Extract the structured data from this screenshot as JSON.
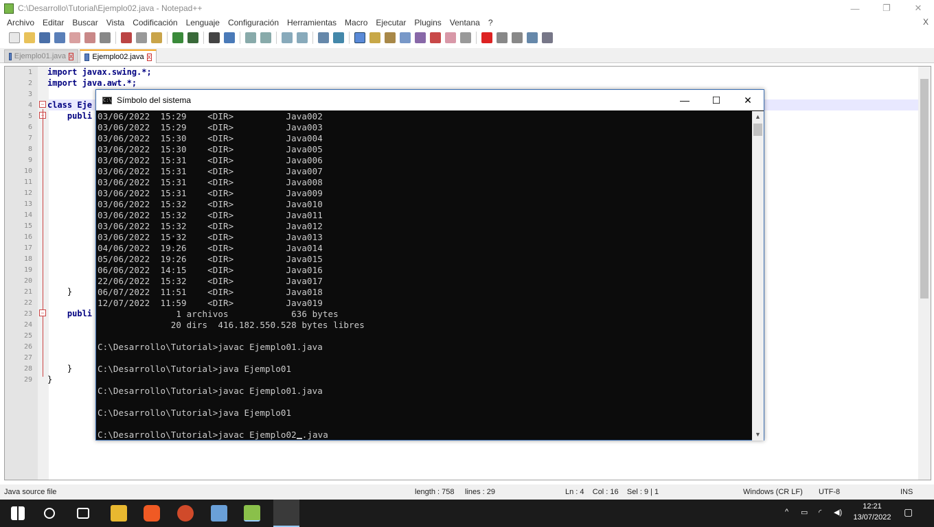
{
  "window": {
    "title": "C:\\Desarrollo\\Tutorial\\Ejemplo02.java - Notepad++"
  },
  "menu": [
    "Archivo",
    "Editar",
    "Buscar",
    "Vista",
    "Codificación",
    "Lenguaje",
    "Configuración",
    "Herramientas",
    "Macro",
    "Ejecutar",
    "Plugins",
    "Ventana",
    "?"
  ],
  "menu_close": "X",
  "tabs": [
    {
      "label": "Ejemplo01.java",
      "active": false
    },
    {
      "label": "Ejemplo02.java",
      "active": true
    }
  ],
  "editor": {
    "line_numbers": [
      "1",
      "2",
      "3",
      "4",
      "5",
      "6",
      "7",
      "8",
      "9",
      "10",
      "11",
      "12",
      "13",
      "14",
      "15",
      "16",
      "17",
      "18",
      "19",
      "20",
      "21",
      "22",
      "23",
      "24",
      "25",
      "26",
      "27",
      "28",
      "29"
    ],
    "visible_code": [
      {
        "line": 1,
        "text": "import javax.swing.*;"
      },
      {
        "line": 2,
        "text": "import java.awt.*;"
      },
      {
        "line": 4,
        "text": "class Eje"
      },
      {
        "line": 5,
        "text": "    publi"
      },
      {
        "line": 21,
        "text": "    }"
      },
      {
        "line": 23,
        "text": "    publi"
      },
      {
        "line": 28,
        "text": "    }"
      },
      {
        "line": 29,
        "text": "}"
      }
    ]
  },
  "cmd": {
    "title": "Símbolo del sistema",
    "lines": [
      "03/06/2022  15:29    <DIR>          Java002",
      "03/06/2022  15:29    <DIR>          Java003",
      "03/06/2022  15:30    <DIR>          Java004",
      "03/06/2022  15:30    <DIR>          Java005",
      "03/06/2022  15:31    <DIR>          Java006",
      "03/06/2022  15:31    <DIR>          Java007",
      "03/06/2022  15:31    <DIR>          Java008",
      "03/06/2022  15:31    <DIR>          Java009",
      "03/06/2022  15:32    <DIR>          Java010",
      "03/06/2022  15:32    <DIR>          Java011",
      "03/06/2022  15:32    <DIR>          Java012",
      "03/06/2022  15:32    <DIR>          Java013",
      "04/06/2022  19:26    <DIR>          Java014",
      "05/06/2022  19:26    <DIR>          Java015",
      "06/06/2022  14:15    <DIR>          Java016",
      "22/06/2022  15:32    <DIR>          Java017",
      "06/07/2022  11:51    <DIR>          Java018",
      "12/07/2022  11:59    <DIR>          Java019",
      "               1 archivos            636 bytes",
      "              20 dirs  416.182.550.528 bytes libres",
      "",
      "C:\\Desarrollo\\Tutorial>javac Ejemplo01.java",
      "",
      "C:\\Desarrollo\\Tutorial>java Ejemplo01",
      "",
      "C:\\Desarrollo\\Tutorial>javac Ejemplo01.java",
      "",
      "C:\\Desarrollo\\Tutorial>java Ejemplo01",
      ""
    ],
    "current_prompt": "C:\\Desarrollo\\Tutorial>javac Ejemplo02",
    "current_input_rest": ".java"
  },
  "status": {
    "file_type": "Java source file",
    "length": "length : 758",
    "lines": "lines : 29",
    "position": "Ln : 4    Col : 16    Sel : 9 | 1",
    "eol": "Windows (CR LF)",
    "encoding": "UTF-8",
    "mode": "INS"
  },
  "taskbar": {
    "time": "12:21",
    "date": "13/07/2022"
  },
  "colors": {
    "accent_tab": "#f2a11a",
    "cmd_bg": "#0c0c0c",
    "cmd_text": "#cccccc",
    "keyword": "#000080"
  }
}
